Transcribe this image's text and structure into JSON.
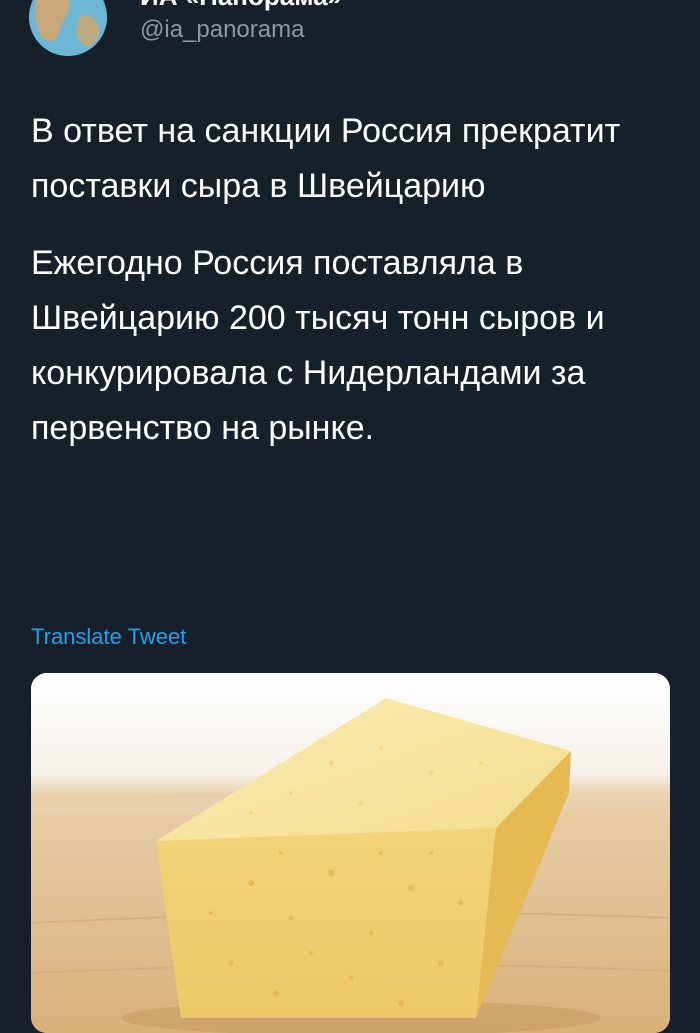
{
  "tweet": {
    "display_name": "ИА «Панорама»",
    "handle": "@ia_panorama",
    "text_paragraphs": [
      "В ответ на санкции Россия прекратит поставки сыра в Швейцарию",
      "Ежегодно Россия поставляла в Швейцарию 200 тысяч тонн сыров и конкурировала с Нидерландами за первенство на рынке."
    ],
    "translate_label": "Translate Tweet",
    "media_subject": "cheese-wedge-photo"
  },
  "icons": {
    "avatar": "globe-icon",
    "menu": "chevron-down-icon"
  },
  "colors": {
    "background": "#15202b",
    "text": "#ffffff",
    "secondary_text": "#8899a6",
    "link": "#1da1f2"
  }
}
